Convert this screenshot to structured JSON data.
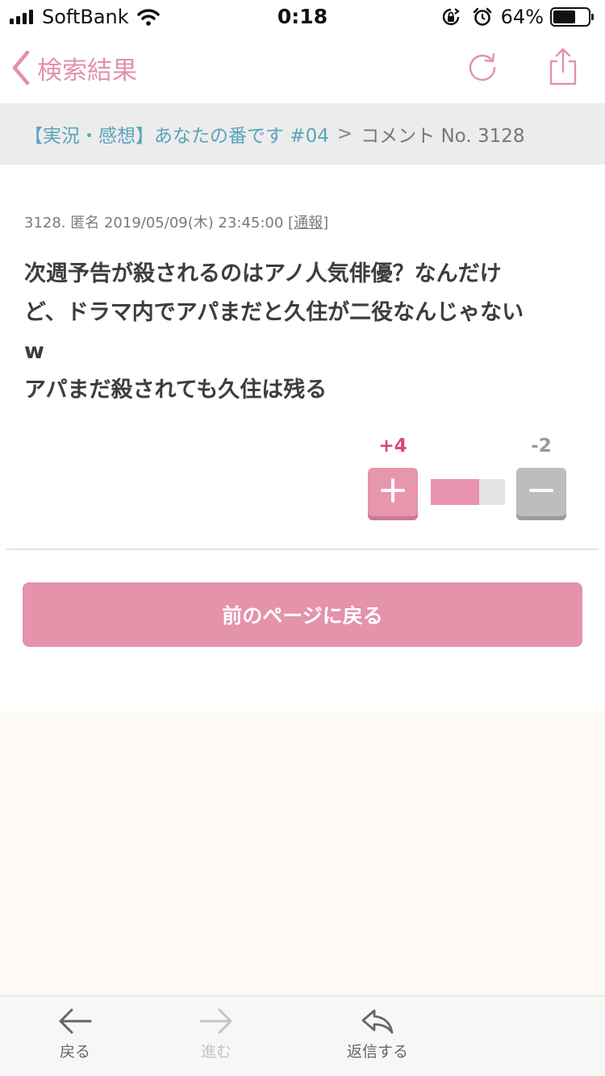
{
  "status_bar": {
    "carrier": "SoftBank",
    "time": "0:18",
    "battery_percent": "64%",
    "battery_level": 0.64
  },
  "nav": {
    "back_label": "検索結果",
    "accent_color": "#e391ad"
  },
  "breadcrumb": {
    "topic": "【実況・感想】あなたの番です #04",
    "separator": ">",
    "current": "コメント No. 3128"
  },
  "comment": {
    "meta_prefix": "3128. 匿名 2019/05/09(木) 23:45:00 [",
    "report_label": "通報",
    "meta_suffix": "]",
    "line1": "次週予告が殺されるのはアノ人気俳優？なんだけ",
    "line2": "ど、ドラマ内でアパまだと久住が二役なんじゃない",
    "line3": "w",
    "line4": "アパまだ殺されても久住は残る"
  },
  "votes": {
    "plus": "+4",
    "minus": "-2",
    "plus_ratio": 0.65
  },
  "prev_page_label": "前のページに戻る",
  "tab_bar": {
    "back": "戻る",
    "forward": "進む",
    "reply": "返信する"
  }
}
